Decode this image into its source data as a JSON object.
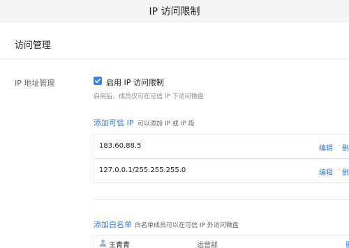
{
  "topbar": {
    "title": "IP 访问限制"
  },
  "section": {
    "title": "访问管理"
  },
  "ip_management": {
    "label": "IP 地址管理",
    "enable_label": "启用 IP 访问限制",
    "enable_checked": true,
    "hint": "启用后，成员仅可在可信 IP 下访问微盘"
  },
  "trusted_ip": {
    "add_label": "添加可信 IP",
    "add_hint": "可以添加 IP 或 IP 段",
    "rows": [
      {
        "ip": "183.60.88.5",
        "edit": "编辑",
        "delete": "删"
      },
      {
        "ip": "127.0.0.1/255.255.255.0",
        "edit": "编辑",
        "delete": "删"
      }
    ],
    "separator": "·"
  },
  "whitelist": {
    "add_label": "添加白名单",
    "add_hint": "白名单成员可以在可信 IP 外访问微盘",
    "rows": [
      {
        "name": "王青青",
        "department": "运营部",
        "delete": "删"
      }
    ]
  },
  "colors": {
    "accent": "#3b79c9",
    "checkbox": "#3b82e6",
    "topbar_bg": "#f5f5f5"
  }
}
